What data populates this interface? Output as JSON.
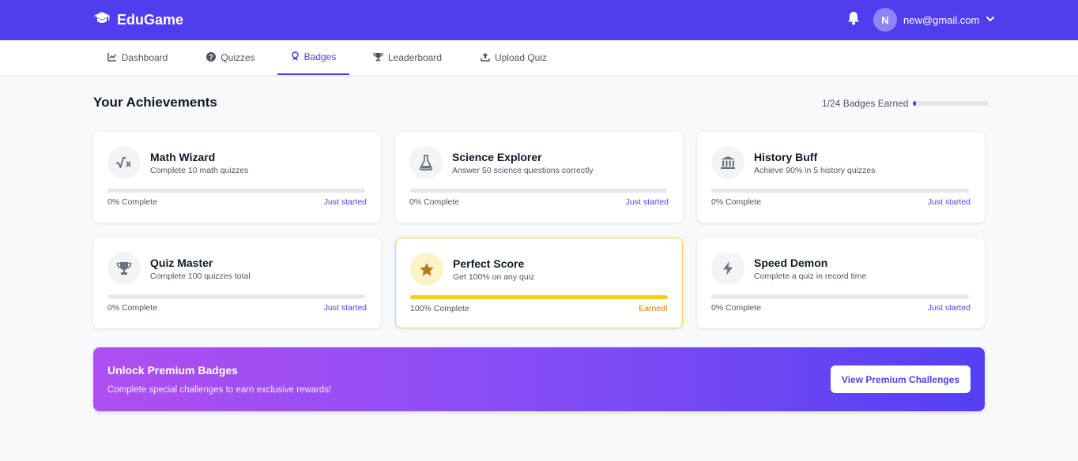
{
  "header": {
    "brand": "EduGame",
    "avatar_initial": "N",
    "user_email": "new@gmail.com"
  },
  "nav": {
    "tabs": [
      {
        "label": "Dashboard",
        "icon": "chart-line-icon"
      },
      {
        "label": "Quizzes",
        "icon": "question-circle-icon"
      },
      {
        "label": "Badges",
        "icon": "medal-icon"
      },
      {
        "label": "Leaderboard",
        "icon": "trophy-icon"
      },
      {
        "label": "Upload Quiz",
        "icon": "upload-icon"
      }
    ],
    "active": "Badges"
  },
  "achievements": {
    "title": "Your Achievements",
    "earned_summary": "1/24 Badges Earned",
    "earned_fraction": 0.0417,
    "badges": [
      {
        "title": "Math Wizard",
        "description": "Complete 10 math quizzes",
        "percent_label": "0% Complete",
        "status": "Just started",
        "progress": 0,
        "icon": "square-root-icon",
        "earned": false
      },
      {
        "title": "Science Explorer",
        "description": "Answer 50 science questions correctly",
        "percent_label": "0% Complete",
        "status": "Just started",
        "progress": 0,
        "icon": "flask-icon",
        "earned": false
      },
      {
        "title": "History Buff",
        "description": "Achieve 90% in 5 history quizzes",
        "percent_label": "0% Complete",
        "status": "Just started",
        "progress": 0,
        "icon": "landmark-icon",
        "earned": false
      },
      {
        "title": "Quiz Master",
        "description": "Complete 100 quizzes total",
        "percent_label": "0% Complete",
        "status": "Just started",
        "progress": 0,
        "icon": "trophy-icon",
        "earned": false
      },
      {
        "title": "Perfect Score",
        "description": "Get 100% on any quiz",
        "percent_label": "100% Complete",
        "status": "Earned!",
        "progress": 1,
        "icon": "star-icon",
        "earned": true
      },
      {
        "title": "Speed Demon",
        "description": "Complete a quiz in record time",
        "percent_label": "0% Complete",
        "status": "Just started",
        "progress": 0,
        "icon": "bolt-icon",
        "earned": false
      }
    ]
  },
  "premium": {
    "title": "Unlock Premium Badges",
    "subtitle": "Complete special challenges to earn exclusive rewards!",
    "button_label": "View Premium Challenges"
  },
  "colors": {
    "primary": "#4f3ef0",
    "earned_gold": "#facc15",
    "earned_text": "#d97706"
  }
}
